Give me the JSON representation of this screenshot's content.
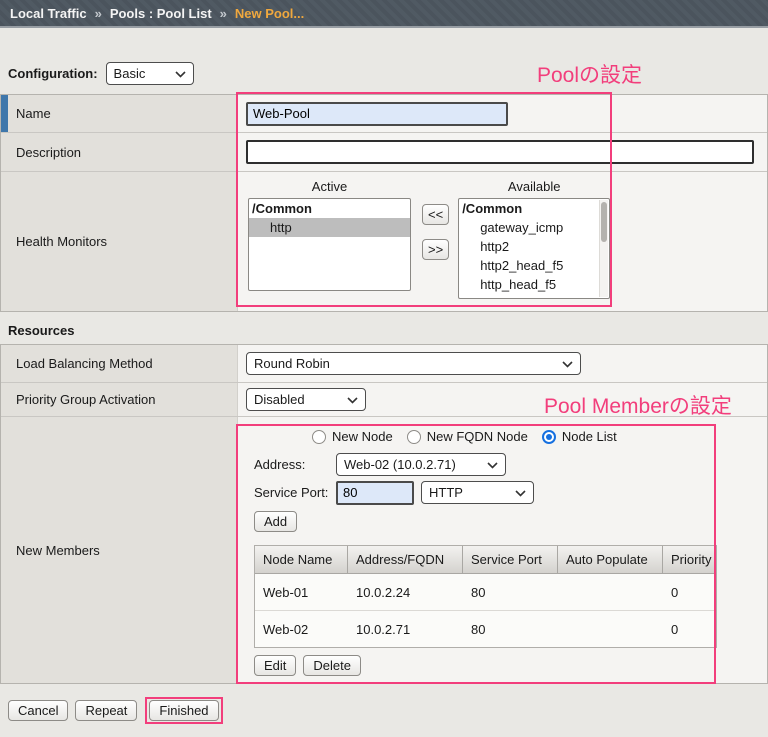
{
  "breadcrumb": {
    "items": [
      "Local Traffic",
      "Pools : Pool List",
      "New Pool..."
    ],
    "separator": "»"
  },
  "annotations": {
    "pool_label": "Poolの設定",
    "member_label": "Pool Memberの設定",
    "accent_color": "#f23e7c"
  },
  "config": {
    "label": "Configuration:",
    "value": "Basic"
  },
  "pool_form": {
    "name": {
      "label": "Name",
      "value": "Web-Pool"
    },
    "description": {
      "label": "Description",
      "value": ""
    },
    "health": {
      "label": "Health Monitors",
      "active_title": "Active",
      "available_title": "Available",
      "active_items": [
        "/Common",
        "http"
      ],
      "available_items": [
        "/Common",
        "gateway_icmp",
        "http2",
        "http2_head_f5",
        "http_head_f5"
      ],
      "move_left": "<<",
      "move_right": ">>"
    }
  },
  "resources": {
    "title": "Resources",
    "lb_method": {
      "label": "Load Balancing Method",
      "value": "Round Robin"
    },
    "priority_group": {
      "label": "Priority Group Activation",
      "value": "Disabled"
    },
    "new_members": {
      "label": "New Members",
      "radios": [
        {
          "label": "New Node",
          "checked": false
        },
        {
          "label": "New FQDN Node",
          "checked": false
        },
        {
          "label": "Node List",
          "checked": true
        }
      ],
      "address": {
        "label": "Address:",
        "value": "Web-02 (10.0.2.71)"
      },
      "service_port": {
        "label": "Service Port:",
        "value": "80",
        "protocol": "HTTP"
      },
      "add_button": "Add",
      "table": {
        "headers": [
          "Node Name",
          "Address/FQDN",
          "Service Port",
          "Auto Populate",
          "Priority"
        ],
        "rows": [
          [
            "Web-01",
            "10.0.2.24",
            "80",
            "",
            "0"
          ],
          [
            "Web-02",
            "10.0.2.71",
            "80",
            "",
            "0"
          ]
        ]
      },
      "edit_button": "Edit",
      "delete_button": "Delete"
    }
  },
  "footer": {
    "cancel": "Cancel",
    "repeat": "Repeat",
    "finished": "Finished"
  }
}
